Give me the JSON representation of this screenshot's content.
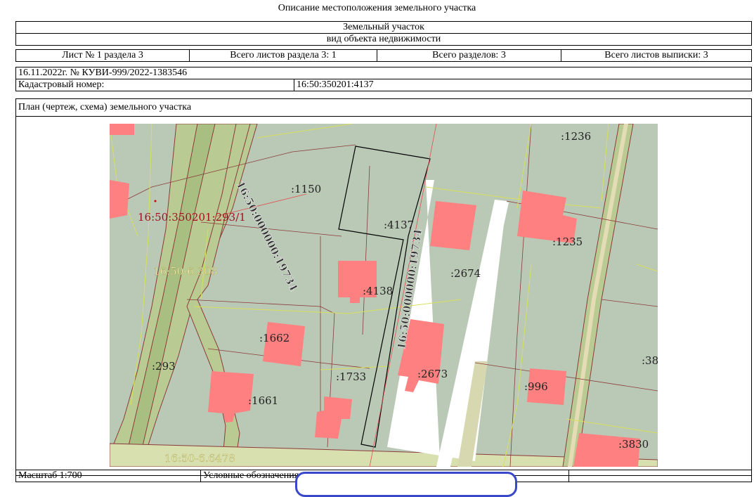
{
  "doc": {
    "title": "Описание местоположения земельного участка",
    "object_name": "Земельный участок",
    "object_type": "вид объекта недвижимости",
    "sheet": "Лист № 1 раздела 3",
    "sheets_in_section": "Всего листов раздела 3: 1",
    "total_sections": "Всего разделов: 3",
    "total_sheets": "Всего листов выписки: 3",
    "date_number": "16.11.2022г. № КУВИ-999/2022-1383546",
    "cadastral_label": "Кадастровый номер:",
    "cadastral_value": "16:50:350201:4137",
    "plan_label": "План (чертеж, схема) земельного участка",
    "scale": "Масштаб 1:700",
    "legend_label": "Условные обозначения:"
  },
  "map": {
    "labels": {
      "l1236": ":1236",
      "l1150": ":1150",
      "l4137": ":4137",
      "l1235": ":1235",
      "l2674": ":2674",
      "l4138": ":4138",
      "l1662": ":1662",
      "l293": ":293",
      "l1733": ":1733",
      "l2673": ":2673",
      "l38": ":38",
      "l996": ":996",
      "l1661": ":1661",
      "l3830": ":3830",
      "parcel_red": "16:50:350201:293/1",
      "zone_6308": "16:50-6.308",
      "zone_6478": "16:50-6.6478",
      "road_left": "16:50:000000:19734",
      "road_right": "16:50:000000:19734"
    },
    "colors": {
      "ground": "#bac8b6",
      "road_band": "#b9cb93",
      "building": "#ff8080",
      "parcel_line": "#8b3a3a",
      "zone_line": "#d8e05a",
      "selected": "#000000"
    }
  }
}
